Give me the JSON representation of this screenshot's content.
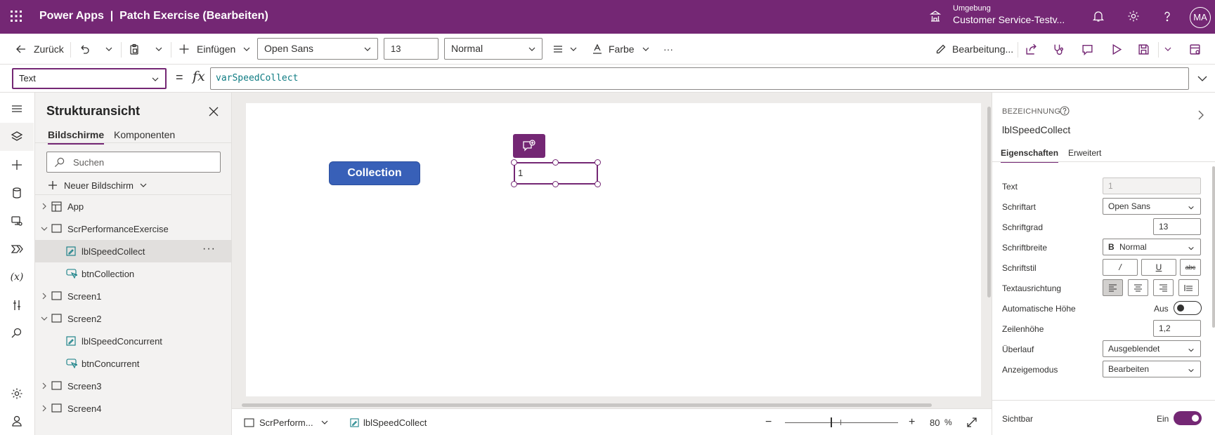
{
  "app": {
    "title": "Power Apps  |  Patch Exercise (Bearbeiten)",
    "environment_label": "Umgebung",
    "environment_value": "Customer Service-Testv...",
    "user_initials": "MA"
  },
  "commandbar": {
    "back_label": "Zurück",
    "insert_label": "Einfügen",
    "font_value": "Open Sans",
    "font_size_value": "13",
    "font_weight_value": "Normal",
    "color_label": "Farbe",
    "more_label": "···",
    "edit_label": "Bearbeitung..."
  },
  "formulabar": {
    "property": "Text",
    "equals": "=",
    "fx": "fx",
    "formula": "varSpeedCollect"
  },
  "tree": {
    "title": "Strukturansicht",
    "tabs": [
      "Bildschirme",
      "Komponenten"
    ],
    "search_placeholder": "Suchen",
    "new_screen_label": "Neuer Bildschirm",
    "more_label": "···",
    "nodes": [
      {
        "label": "App",
        "icon": "app-icon"
      },
      {
        "label": "ScrPerformanceExercise",
        "icon": "screen-icon"
      },
      {
        "label": "lblSpeedCollect",
        "icon": "label-icon"
      },
      {
        "label": "btnCollection",
        "icon": "button-icon"
      },
      {
        "label": "Screen1",
        "icon": "screen-icon"
      },
      {
        "label": "Screen2",
        "icon": "screen-icon"
      },
      {
        "label": "lblSpeedConcurrent",
        "icon": "label-icon"
      },
      {
        "label": "btnConcurrent",
        "icon": "button-icon"
      },
      {
        "label": "Screen3",
        "icon": "screen-icon"
      },
      {
        "label": "Screen4",
        "icon": "screen-icon"
      }
    ]
  },
  "canvas": {
    "button_text": "Collection",
    "label_value": "1"
  },
  "statusbar": {
    "screen_name": "ScrPerform...",
    "control_name": "lblSpeedCollect",
    "zoom_value": "80",
    "zoom_unit": "%",
    "zoom_minus": "−",
    "zoom_plus": "+"
  },
  "properties": {
    "caption": "BEZEICHNUNG",
    "object_name": "lblSpeedCollect",
    "tabs": [
      "Eigenschaften",
      "Erweitert"
    ],
    "rows": {
      "text_label": "Text",
      "text_value": "1",
      "font_label": "Schriftart",
      "font_value": "Open Sans",
      "size_label": "Schriftgrad",
      "size_value": "13",
      "weight_label": "Schriftbreite",
      "weight_prefix": "B",
      "weight_value": "Normal",
      "style_label": "Schriftstil",
      "style_italic": "/",
      "style_underline": "U",
      "style_strike": "abc",
      "align_label": "Textausrichtung",
      "autoheight_label": "Automatische Höhe",
      "autoheight_state": "Aus",
      "lineheight_label": "Zeilenhöhe",
      "lineheight_value": "1,2",
      "overflow_label": "Überlauf",
      "overflow_value": "Ausgeblendet",
      "displaymode_label": "Anzeigemodus",
      "displaymode_value": "Bearbeiten",
      "visible_label": "Sichtbar",
      "visible_state": "Ein"
    }
  }
}
